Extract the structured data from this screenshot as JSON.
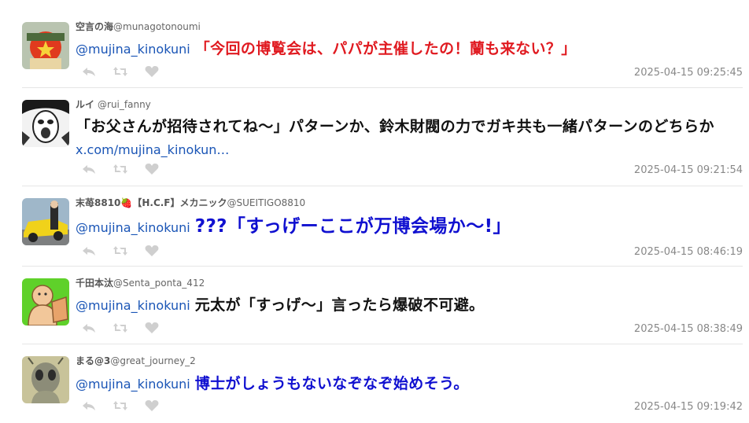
{
  "colors": {
    "mention": "#1a55b6",
    "red_text": "#e01a20",
    "blue_text": "#1010d0",
    "timestamp": "#888888"
  },
  "action_icons": [
    "reply-icon",
    "retweet-icon",
    "like-icon"
  ],
  "tweets": [
    {
      "display_name": "空言の海",
      "handle": "@munagotonoumi",
      "mention": "@mujina_kinokuni",
      "text": "「今回の博覧会は、パパが主催したの！蘭も来ない？」",
      "timestamp": "2025-04-15 09:25:45"
    },
    {
      "display_name": "ルイ",
      "handle": "@rui_fanny",
      "text": "「お父さんが招待されてね〜」パターンか、鈴木財閥の力でガキ共も一緒パターンのどちらか",
      "link": "x.com/mujina_kinokun…",
      "timestamp": "2025-04-15 09:21:54"
    },
    {
      "display_name": "末苺8810🍓【H.C.F】メカニック",
      "handle": "@SUEITIGO8810",
      "mention": "@mujina_kinokuni",
      "text": "???「すっげーここが万博会場か〜!」",
      "timestamp": "2025-04-15 08:46:19"
    },
    {
      "display_name": "千田本汰",
      "handle": "@Senta_ponta_412",
      "mention": "@mujina_kinokuni",
      "text": "元太が「すっげ〜」言ったら爆破不可避。",
      "timestamp": "2025-04-15 08:38:49"
    },
    {
      "display_name": "まる@3",
      "handle": "@great_journey_2",
      "mention": "@mujina_kinokuni",
      "text": "博士がしょうもないなぞなぞ始めそう。",
      "timestamp": "2025-04-15 09:19:42"
    }
  ]
}
